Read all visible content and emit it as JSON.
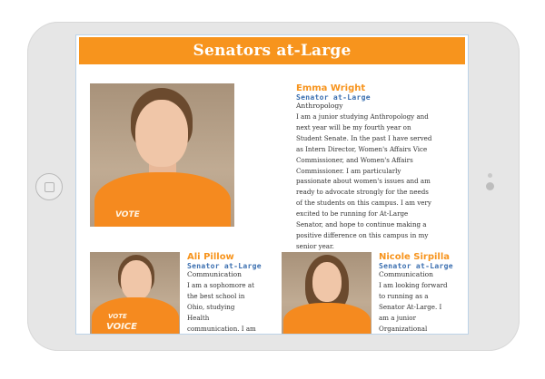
{
  "page": {
    "title": "Senators at-Large"
  },
  "featured": {
    "name": "Emma Wright",
    "role": "Senator at-Large",
    "major": "Anthropology",
    "bio": "I am a junior studying Anthropology and next year will be my fourth year on Student Senate. In the past I have served as Intern Director, Women's Affairs Vice Commissioner, and Women's Affairs Commissioner. I am particularly passionate about women's issues and am ready to advocate strongly for the needs of the students on this campus. I am very excited to be running for At-Large Senator, and hope to continue making a positive difference on this campus in my senior year."
  },
  "candidates": [
    {
      "name": "Ali Pillow",
      "role": "Senator at-Large",
      "major": "Communication",
      "bio": "I am a sophomore at the best school in Ohio, studying Health communication. I am running for"
    },
    {
      "name": "Nicole Sirpilla",
      "role": "Senator at-Large",
      "major": "Communication",
      "bio": "I am looking forward to running as a Senator At-Large. I am a junior Organizational Communication"
    }
  ],
  "shirt_print": {
    "featured": "VOTE",
    "candidate_1_top": "VOTE",
    "candidate_1_bottom": "VOICE"
  },
  "colors": {
    "accent": "#f7941d",
    "role": "#3b6fb0",
    "text": "#333333",
    "device": "#e6e6e6"
  },
  "icons": {
    "home": "home-button-icon",
    "camera": "camera-icon"
  }
}
